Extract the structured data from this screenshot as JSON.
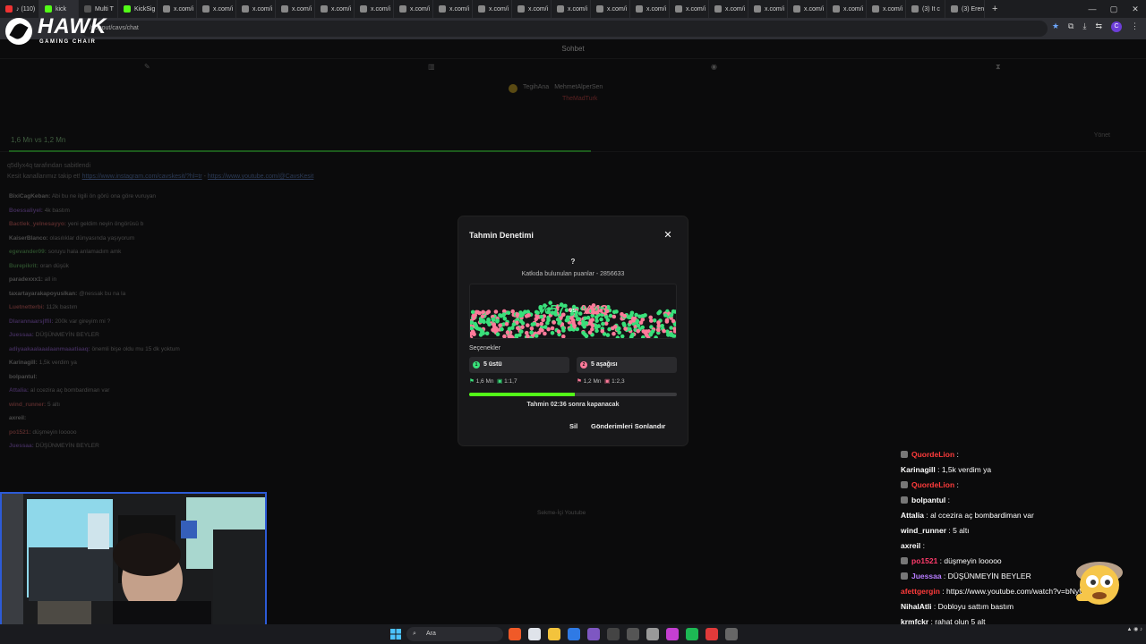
{
  "browser": {
    "tabs": [
      {
        "label": "♪ (110)",
        "color": "#e33"
      },
      {
        "label": "kick",
        "color": "#53fc18",
        "active": true
      },
      {
        "label": "Multi T",
        "color": "#555"
      },
      {
        "label": "KickSig",
        "color": "#53fc18"
      },
      {
        "label": "x.com/i",
        "color": "#888"
      },
      {
        "label": "x.com/i",
        "color": "#888"
      },
      {
        "label": "x.com/i",
        "color": "#888"
      },
      {
        "label": "x.com/i",
        "color": "#888"
      },
      {
        "label": "x.com/i",
        "color": "#888"
      },
      {
        "label": "x.com/i",
        "color": "#888"
      },
      {
        "label": "x.com/i",
        "color": "#888"
      },
      {
        "label": "x.com/i",
        "color": "#888"
      },
      {
        "label": "x.com/i",
        "color": "#888"
      },
      {
        "label": "x.com/i",
        "color": "#888"
      },
      {
        "label": "x.com/i",
        "color": "#888"
      },
      {
        "label": "x.com/i",
        "color": "#888"
      },
      {
        "label": "x.com/i",
        "color": "#888"
      },
      {
        "label": "x.com/i",
        "color": "#888"
      },
      {
        "label": "x.com/i",
        "color": "#888"
      },
      {
        "label": "x.com/i",
        "color": "#888"
      },
      {
        "label": "x.com/i",
        "color": "#888"
      },
      {
        "label": "x.com/i",
        "color": "#888"
      },
      {
        "label": "x.com/i",
        "color": "#888"
      },
      {
        "label": "(3) It c",
        "color": "#888"
      },
      {
        "label": "(3) Eren",
        "color": "#888"
      }
    ],
    "url": "/popout/cavs/chat"
  },
  "logo": {
    "brand": "HAWK",
    "sub": "GAMING CHAIR"
  },
  "chat_header": "Sohbet",
  "leaders": {
    "row1_a": "TegihAna",
    "row1_b": "MehmetAlperSen",
    "row2": "TheMadTurk"
  },
  "prediction_bar": {
    "text": "1,6 Mn vs 1,2 Mn",
    "manage": "Yönet"
  },
  "pinned": {
    "line1": "q5dlyx4q tarafından sabitlendi",
    "line2_prefix": "Kesit kanallarımız takip et!",
    "link1": "https://www.instagram.com/cavskesit/?hl=tr",
    "sep": " - ",
    "link2": "https://www.youtube.com/@CavsKesit"
  },
  "bg_chat": [
    {
      "user": "BixiCagKeban:",
      "msg": "Abi bu ne ilgili ön görü ona göre vuruyan",
      "color": "#4a4a4a"
    },
    {
      "user": "Boessaliyel:",
      "msg": "4k bastım",
      "color": "#3d2a55"
    },
    {
      "user": "Bactlek_yelnesayyo:",
      "msg": "yeni geldim neyin öngörüsü b",
      "color": "#552a2a"
    },
    {
      "user": "KaiserBlanco:",
      "msg": "olasılıklar dünyasında yaşıyorum",
      "color": "#4a4a4a"
    },
    {
      "user": "egevander09:",
      "msg": "soruyu hala anlamadım amk",
      "color": "#2a4a2a"
    },
    {
      "user": "Burepikrit:",
      "msg": "oran düşük",
      "color": "#2a4a2a"
    },
    {
      "user": "paradexxx1:",
      "msg": "all in",
      "color": "#4a4a4a"
    },
    {
      "user": "taxartayarakapoyuslkan:",
      "msg": "@nessak bu na la",
      "color": "#4a4a4a"
    },
    {
      "user": "Luetnetterbi:",
      "msg": "112k bastım",
      "color": "#552a2a"
    },
    {
      "user": "Dlarannaarsjffil:",
      "msg": "200k var gireyim mi ?",
      "color": "#3d2a55"
    },
    {
      "user": "Juessaa:",
      "msg": "DÜŞÜNMEYİN BEYLER",
      "color": "#3d2a55"
    },
    {
      "user": "adiyaakaalaaalaanmaaatiaaq:",
      "msg": "önemli bişe oldu mu 15 dk yoktum",
      "color": "#3d2a55"
    },
    {
      "user": "Karinagill:",
      "msg": "1,5k verdim ya",
      "color": "#4a4a4a"
    },
    {
      "user": "bolpantul:",
      "msg": "",
      "color": "#4a4a4a"
    },
    {
      "user": "Attalia:",
      "msg": "al ccezira aç bombardiman var",
      "color": "#3d2a55"
    },
    {
      "user": "wind_runner:",
      "msg": "5 altı",
      "color": "#552a2a"
    },
    {
      "user": "axreil:",
      "msg": "",
      "color": "#4a4a4a"
    },
    {
      "user": "po1521:",
      "msg": "düşmeyin looooo",
      "color": "#552a2a"
    },
    {
      "user": "Juessaa:",
      "msg": "DÜŞÜNMEYİN BEYLER",
      "color": "#3d2a55"
    }
  ],
  "modal": {
    "title": "Tahmin Denetimi",
    "question": "?",
    "points_label": "Katkıda bulunulan puanlar - 2856633",
    "pct_a": "%57",
    "vs": "vs",
    "pct_b": "%43",
    "options_header": "Seçenekler",
    "option_a": {
      "num": "1",
      "label": "5 üstü",
      "amount": "1,6 Mn",
      "ratio": "1:1,7"
    },
    "option_b": {
      "num": "2",
      "label": "5 aşağısı",
      "amount": "1,2 Mn",
      "ratio": "1:2,3"
    },
    "progress_fraction": 0.51,
    "closing": "Tahmin 02:36 sonra kapanacak",
    "delete": "Sil",
    "end": "Gönderimleri Sonlandır"
  },
  "sekme": "Sekme-İçi Youtube",
  "overlay_chat": [
    {
      "user": "QuordeLion",
      "msg": "",
      "color": "#ff3b3b",
      "sq": true
    },
    {
      "user": "Karinagill",
      "msg": "1,5k verdim ya",
      "color": "#ffffff",
      "sq": false
    },
    {
      "user": "QuordeLion",
      "msg": "",
      "color": "#ff3b3b",
      "sq": true
    },
    {
      "user": "bolpantul",
      "msg": "",
      "color": "#ffffff",
      "sq": true
    },
    {
      "user": "Attalia",
      "msg": "al ccezira aç bombardiman var",
      "color": "#ffffff",
      "sq": false
    },
    {
      "user": "wind_runner",
      "msg": "5 altı",
      "color": "#ffffff",
      "sq": false
    },
    {
      "user": "axreil",
      "msg": "",
      "color": "#ffffff",
      "sq": false
    },
    {
      "user": "po1521",
      "msg": "düşmeyin looooo",
      "color": "#ff3b6b",
      "sq": true
    },
    {
      "user": "Juessaa",
      "msg": "DÜŞÜNMEYİN BEYLER",
      "color": "#b77cff",
      "sq": true
    },
    {
      "user": "afettgergin",
      "msg": "https://www.youtube.com/watch?v=bNyUyrR0PHo",
      "color": "#ff3b3b",
      "sq": false
    },
    {
      "user": "NihalAtli",
      "msg": "Dobloyu sattım bastım",
      "color": "#ffffff",
      "sq": false
    },
    {
      "user": "krmfckr",
      "msg": "rahat olun 5 alt",
      "color": "#ffffff",
      "sq": false
    }
  ],
  "taskbar": {
    "search": "Ara"
  },
  "colors": {
    "accent": "#53fc18",
    "pink": "#ff7a9a",
    "green_ball": "#39e07a"
  }
}
